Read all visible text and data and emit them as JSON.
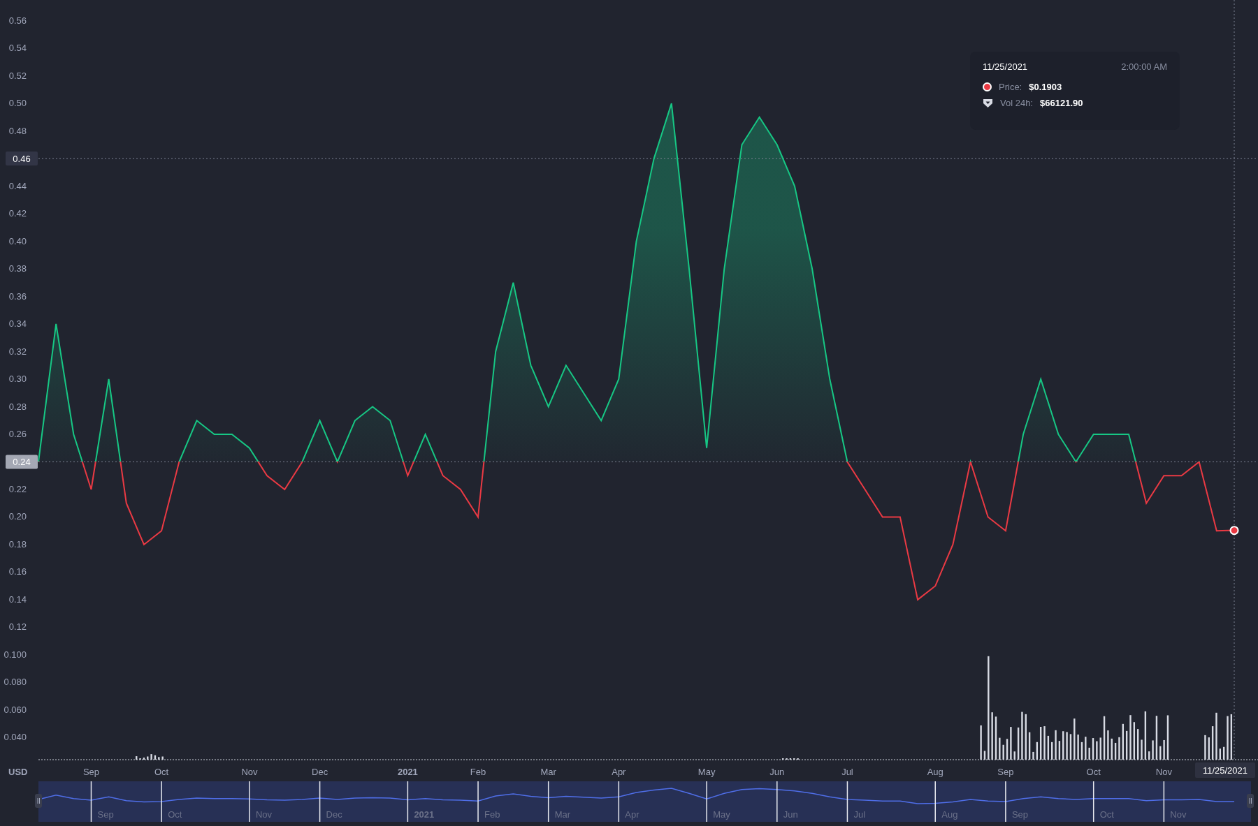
{
  "chart": {
    "chart_data": {
      "type": "area",
      "ylabel": "USD",
      "ylim": [
        0.024,
        0.575
      ],
      "categories": [
        null,
        null,
        null,
        "Sep",
        null,
        null,
        null,
        "Oct",
        null,
        null,
        null,
        null,
        "Nov",
        null,
        null,
        null,
        "Dec",
        null,
        null,
        null,
        null,
        "2021",
        null,
        null,
        null,
        "Feb",
        null,
        null,
        null,
        "Mar",
        null,
        null,
        null,
        "Apr",
        null,
        null,
        null,
        null,
        "May",
        null,
        null,
        null,
        "Jun",
        null,
        null,
        null,
        "Jul",
        null,
        null,
        null,
        null,
        "Aug",
        null,
        null,
        null,
        "Sep",
        null,
        null,
        null,
        null,
        "Oct",
        null,
        null,
        null,
        "Nov",
        null,
        null,
        null,
        null
      ],
      "series": [
        {
          "color": "#16c784",
          "values": [
            0.24,
            0.34,
            0.26,
            0.22,
            0.3,
            0.21,
            0.18,
            0.19,
            0.24,
            0.27,
            0.26,
            0.26,
            0.25,
            0.23,
            0.22,
            0.24,
            0.27,
            0.24,
            0.27,
            0.28,
            0.27,
            0.23,
            0.26,
            0.23,
            0.22,
            0.2,
            0.32,
            0.37,
            0.31,
            0.28,
            0.31,
            0.29,
            0.27,
            0.3,
            0.4,
            0.46,
            0.5,
            0.38,
            0.25,
            0.38,
            0.47,
            0.49,
            0.47,
            0.44,
            0.38,
            0.3,
            0.24,
            0.22,
            0.2,
            0.2,
            0.14,
            0.15,
            0.18,
            0.24,
            0.2,
            0.19,
            0.26,
            0.3,
            0.26,
            0.24,
            0.26,
            0.26,
            0.26,
            0.21,
            0.23,
            0.23,
            0.24,
            0.19,
            0.1903
          ]
        }
      ],
      "yticks": [
        {
          "value": 0.56,
          "label": "0.56"
        },
        {
          "value": 0.54,
          "label": "0.54"
        },
        {
          "value": 0.52,
          "label": "0.52"
        },
        {
          "value": 0.5,
          "label": "0.50"
        },
        {
          "value": 0.48,
          "label": "0.48"
        },
        {
          "value": 0.44,
          "label": "0.44"
        },
        {
          "value": 0.42,
          "label": "0.42"
        },
        {
          "value": 0.4,
          "label": "0.40"
        },
        {
          "value": 0.38,
          "label": "0.38"
        },
        {
          "value": 0.36,
          "label": "0.36"
        },
        {
          "value": 0.34,
          "label": "0.34"
        },
        {
          "value": 0.32,
          "label": "0.32"
        },
        {
          "value": 0.3,
          "label": "0.30"
        },
        {
          "value": 0.28,
          "label": "0.28"
        },
        {
          "value": 0.26,
          "label": "0.26"
        },
        {
          "value": 0.22,
          "label": "0.22"
        },
        {
          "value": 0.2,
          "label": "0.20"
        },
        {
          "value": 0.18,
          "label": "0.18"
        },
        {
          "value": 0.16,
          "label": "0.16"
        },
        {
          "value": 0.14,
          "label": "0.14"
        },
        {
          "value": 0.12,
          "label": "0.12"
        },
        {
          "value": 0.1,
          "label": "0.100"
        },
        {
          "value": 0.08,
          "label": "0.080"
        },
        {
          "value": 0.06,
          "label": "0.060"
        },
        {
          "value": 0.04,
          "label": "0.040"
        }
      ]
    },
    "crosshair": {
      "price_label": "0.46",
      "date_label": "11/25/2021"
    },
    "baseline": {
      "label": "0.24"
    }
  },
  "tooltip": {
    "date": "11/25/2021",
    "time": "2:00:00 AM",
    "rows": [
      {
        "kind": "price",
        "label": "Price:",
        "value": "$0.1903",
        "color": "#ea3943"
      },
      {
        "kind": "volume",
        "label": "Vol 24h:",
        "value": "$66121.90"
      }
    ]
  },
  "navigator": {
    "labels": [
      "Sep",
      "Oct",
      "Nov",
      "Dec",
      "2021",
      "Feb",
      "Mar",
      "Apr",
      "May",
      "Jun",
      "Jul",
      "Aug",
      "Sep",
      "Oct",
      "Nov"
    ]
  }
}
